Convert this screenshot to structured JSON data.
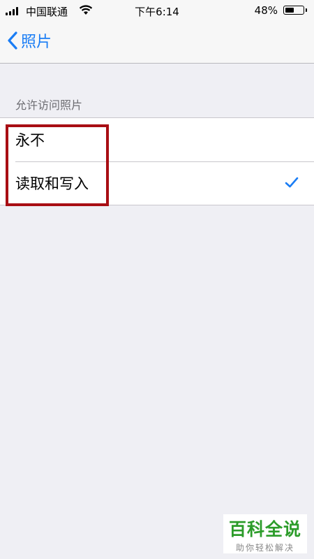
{
  "status_bar": {
    "carrier": "中国联通",
    "time": "下午6:14",
    "battery_percent_text": "48%",
    "battery_level": 0.48
  },
  "nav": {
    "back_label": "照片"
  },
  "section": {
    "header": "允许访问照片",
    "options": [
      {
        "label": "永不",
        "selected": false
      },
      {
        "label": "读取和写入",
        "selected": true
      }
    ]
  },
  "watermark": {
    "title": "百科全说",
    "subtitle": "助你轻松解决"
  },
  "colors": {
    "accent": "#1a7df5",
    "highlight_border": "#a80e14",
    "watermark_green": "#2c9c2a",
    "background": "#efeff4"
  }
}
